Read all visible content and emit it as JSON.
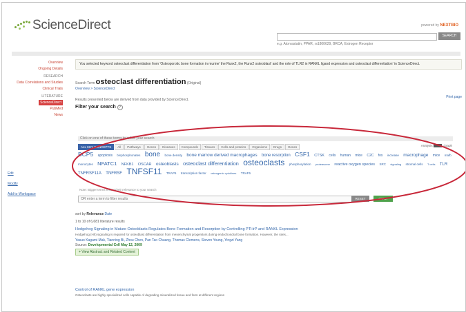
{
  "header": {
    "logo_text": "ScienceDirect",
    "powered_by": "powered by",
    "powered_brand": "NEXTBIO",
    "search_button": "SEARCH",
    "search_hint": "e.g. Atorvastatin, PPAR, rs1800629, BRCA, Estrogen Receptor"
  },
  "sidebar": {
    "items": [
      {
        "label": "Overview",
        "type": "link"
      },
      {
        "label": "Ongoing Details",
        "type": "link"
      },
      {
        "label": "RESEARCH",
        "type": "head"
      },
      {
        "label": "Data Correlations and Studies",
        "type": "link"
      },
      {
        "label": "Clinical Trials",
        "type": "link"
      },
      {
        "label": "LITERATURE",
        "type": "head"
      },
      {
        "label": "ScienceDirect",
        "type": "active"
      },
      {
        "label": "PubMed",
        "type": "link"
      },
      {
        "label": "News",
        "type": "link"
      }
    ],
    "extra_links": [
      "Edit",
      "Modify",
      "Add to Workspace"
    ]
  },
  "main": {
    "notice": "You selected keyword osteoclast differentiation from 'Osteoporotic bone formation in murine' the Runx2, the Runx2 osteoblast' and the role of TLR2 in RANKL ligand expression and osteoclast differentiation' in ScienceDirect.",
    "search_term_label": "Search Term",
    "search_term": "osteoclast differentiation",
    "search_term_suffix": "(Original)",
    "breadcrumb": "Overview > ScienceDirect",
    "print_link": "Print page",
    "results_note": "Results presented below are derived from data provided by ScienceDirect.",
    "filter_title": "Filter your search",
    "filter_prompt": "Click on one of these terms to refine your search"
  },
  "filter": {
    "tabs": [
      "ALL KEY CONCEPTS",
      "All",
      "Pathways",
      "Genes",
      "Diseases",
      "Compounds",
      "Tissues",
      "Cells and proteins",
      "Organisms",
      "Drugs",
      "Genes"
    ],
    "right_label": "Analysis",
    "right_label2": "Graph",
    "cloud": [
      {
        "t": "BCP5",
        "s": 8.5
      },
      {
        "t": "apoptosis",
        "s": 5
      },
      {
        "t": "bisphosphonates",
        "s": 4.5
      },
      {
        "t": "bone",
        "s": 10
      },
      {
        "t": "bone density",
        "s": 4.5
      },
      {
        "t": "bone marrow derived macrophages",
        "s": 6.5
      },
      {
        "t": "bone resorption",
        "s": 6
      },
      {
        "t": "CSF1",
        "s": 8.5
      },
      {
        "t": "CTSK",
        "s": 5.5
      },
      {
        "t": "cells",
        "s": 5
      },
      {
        "t": "human",
        "s": 5
      },
      {
        "t": "mice",
        "s": 5
      },
      {
        "t": "C2C",
        "s": 5
      },
      {
        "t": "fos",
        "s": 5
      },
      {
        "t": "increase",
        "s": 4.5
      },
      {
        "t": "macrophage",
        "s": 6.5
      },
      {
        "t": "mice",
        "s": 5
      },
      {
        "t": "mafb",
        "s": 4.5
      },
      {
        "t": "monocytes",
        "s": 4.5
      },
      {
        "t": "NFATC1",
        "s": 7.5
      },
      {
        "t": "NFKB1",
        "s": 5.5
      },
      {
        "t": "OSCAR",
        "s": 5.5
      },
      {
        "t": "osteoblasts",
        "s": 6.5
      },
      {
        "t": "osteoclast differentiation",
        "s": 7.5
      },
      {
        "t": "osteoclasts",
        "s": 12
      },
      {
        "t": "phosphorylation",
        "s": 4.5
      },
      {
        "t": "proteasome",
        "s": 4
      },
      {
        "t": "reactive oxygen species",
        "s": 5.5
      },
      {
        "t": "SRC",
        "s": 4.5
      },
      {
        "t": "signaling",
        "s": 4
      },
      {
        "t": "stromal cells",
        "s": 4.5
      },
      {
        "t": "T cells",
        "s": 4
      },
      {
        "t": "TLR",
        "s": 6
      },
      {
        "t": "TNFRSF11A",
        "s": 6
      },
      {
        "t": "TNFRSF",
        "s": 6
      },
      {
        "t": "TNFSF11",
        "s": 12
      },
      {
        "t": "TRAP5",
        "s": 4.5
      },
      {
        "t": "transcription factor",
        "s": 4.5
      },
      {
        "t": "osteogenic cytokines",
        "s": 4
      },
      {
        "t": "TRAF6",
        "s": 4.5
      }
    ],
    "cloud_footer": "Note: Bigger terms reflect their relevance to your search",
    "input_placeholder": "OR enter a term to filter results",
    "reset_label": "RESET",
    "apply_label": "APPLY"
  },
  "results": {
    "sort_label": "sort by",
    "sort_value": "Relevance",
    "sort_alt": "Date",
    "count": "1 to 10 of 6,681 literature results",
    "articles": [
      {
        "title": "Hedgehog Signaling in Mature Osteoblasts Regulates Bone Formation and Resorption by Controlling PTHrP and RANKL Expression",
        "snippet": "Hedgehog (Hh) signaling is required for osteoblast differentiation from mesenchymal progenitors during endochondral bone formation. However, the roles...",
        "authors": "Yasuo Kagami Mak, Tianning Bi, Zhou Chen, Pan Tao Chuang, Thomas Clemens, Steven Young, Yingzi Yang",
        "source_label": "Source",
        "source": "Developmental Cell",
        "date": "May 12, 2009",
        "add_label": "+ View Abstract and Related Content"
      },
      {
        "title": "Control of RANKL gene expression",
        "snippet": "Osteoclasts are highly specialized cells capable of degrading mineralized tissue and form at different regions",
        "authors": "",
        "source_label": "",
        "source": "",
        "date": "",
        "add_label": ""
      }
    ]
  }
}
